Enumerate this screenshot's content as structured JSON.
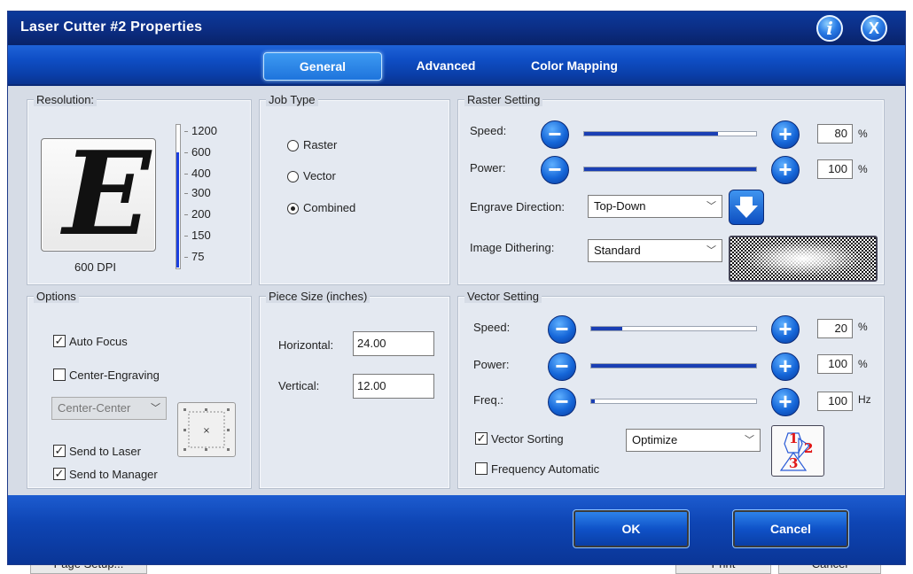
{
  "background": {
    "page_setup_label": "Page Setup...",
    "print_label": "Print",
    "cancel_label": "Cancel"
  },
  "window": {
    "title": "Laser Cutter #2 Properties",
    "info_icon": "i",
    "close_icon": "X"
  },
  "tabs": [
    {
      "label": "General",
      "active": true
    },
    {
      "label": "Advanced",
      "active": false
    },
    {
      "label": "Color Mapping",
      "active": false
    }
  ],
  "resolution": {
    "title": "Resolution:",
    "preview_letter": "E",
    "current_dpi": "600 DPI",
    "ticks": [
      "1200",
      "600",
      "400",
      "300",
      "200",
      "150",
      "75"
    ]
  },
  "job_type": {
    "title": "Job Type",
    "options": [
      "Raster",
      "Vector",
      "Combined"
    ],
    "selected": "Combined"
  },
  "raster": {
    "title": "Raster Setting",
    "speed_label": "Speed:",
    "speed_value": "80",
    "speed_unit": "%",
    "speed_fraction": 0.78,
    "power_label": "Power:",
    "power_value": "100",
    "power_unit": "%",
    "power_fraction": 1.0,
    "engrave_direction_label": "Engrave Direction:",
    "engrave_direction_value": "Top-Down",
    "image_dithering_label": "Image Dithering:",
    "image_dithering_value": "Standard"
  },
  "options": {
    "title": "Options",
    "auto_focus": {
      "label": "Auto Focus",
      "checked": true
    },
    "center_engraving": {
      "label": "Center-Engraving",
      "checked": false
    },
    "center_select_value": "Center-Center",
    "send_to_laser": {
      "label": "Send to Laser",
      "checked": true
    },
    "send_to_manager": {
      "label": "Send to Manager",
      "checked": true
    }
  },
  "piece_size": {
    "title": "Piece Size (inches)",
    "horizontal_label": "Horizontal:",
    "horizontal_value": "24.00",
    "vertical_label": "Vertical:",
    "vertical_value": "12.00"
  },
  "vector": {
    "title": "Vector Setting",
    "speed_label": "Speed:",
    "speed_value": "20",
    "speed_unit": "%",
    "speed_fraction": 0.19,
    "power_label": "Power:",
    "power_value": "100",
    "power_unit": "%",
    "power_fraction": 1.0,
    "freq_label": "Freq.:",
    "freq_value": "100",
    "freq_unit": "Hz",
    "freq_fraction": 0.01,
    "vector_sorting": {
      "label": "Vector Sorting",
      "checked": true
    },
    "sorting_value": "Optimize",
    "frequency_automatic": {
      "label": "Frequency Automatic",
      "checked": false
    },
    "sort_icon_numbers": [
      "1",
      "2",
      "3"
    ]
  },
  "footer": {
    "ok_label": "OK",
    "cancel_label": "Cancel"
  },
  "colors": {
    "title_bar": "#0c2e85",
    "accent": "#1566d8",
    "body": "#d6dce6"
  }
}
